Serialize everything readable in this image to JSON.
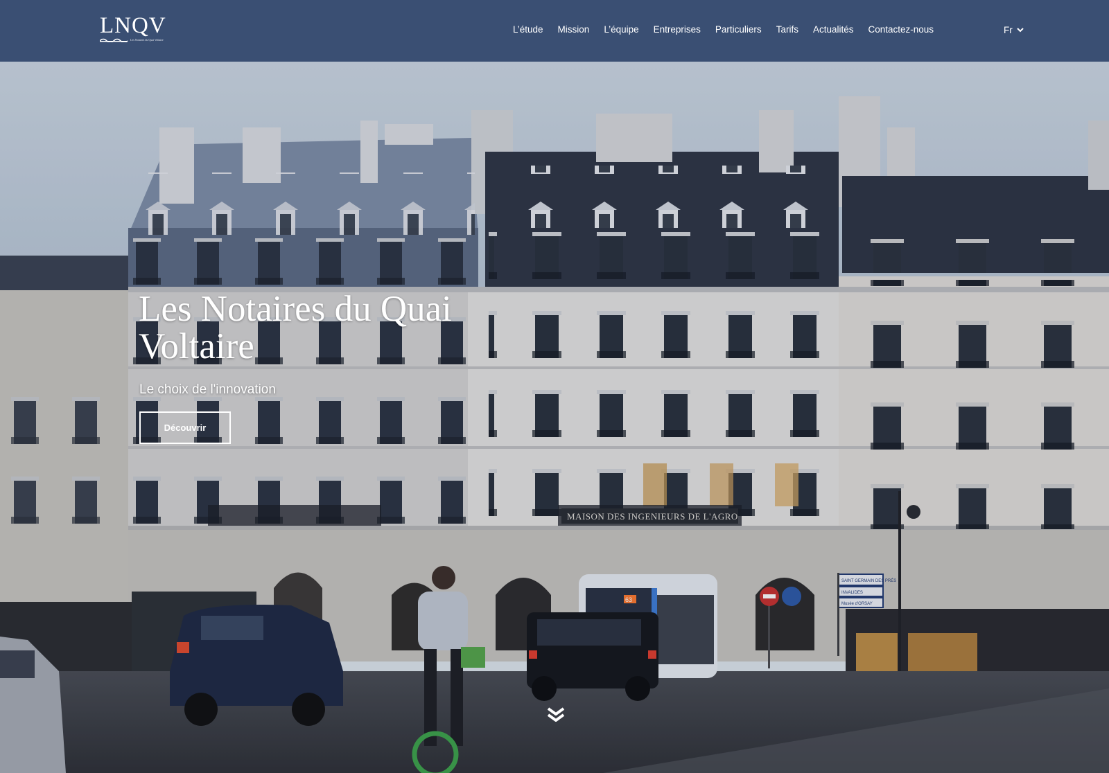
{
  "header": {
    "logo": {
      "text": "LNQV",
      "subtitle": "Les Notaires du Quai Voltaire"
    },
    "nav": [
      {
        "label": "L’étude"
      },
      {
        "label": "Mission"
      },
      {
        "label": "L’équipe"
      },
      {
        "label": "Entreprises"
      },
      {
        "label": "Particuliers"
      },
      {
        "label": "Tarifs"
      },
      {
        "label": "Actualités"
      },
      {
        "label": "Contactez-nous"
      }
    ],
    "language": {
      "label": "Fr",
      "icon": "chevron-down-icon"
    }
  },
  "hero": {
    "title": "Les Notaires du Quai Voltaire",
    "subtitle": "Le choix de l'innovation",
    "cta_label": "Découvrir",
    "scroll_icon": "double-chevron-down-icon",
    "photo_signs": {
      "building_sign": "MAISON DES INGENIEURS DE L'AGRO",
      "direction_signs": [
        "SAINT GERMAIN DES PRÉS",
        "INVALIDES",
        "Musée d'ORSAY"
      ],
      "bus_number": "63"
    }
  },
  "colors": {
    "header_bg": "#3a4f73",
    "text": "#ffffff"
  }
}
